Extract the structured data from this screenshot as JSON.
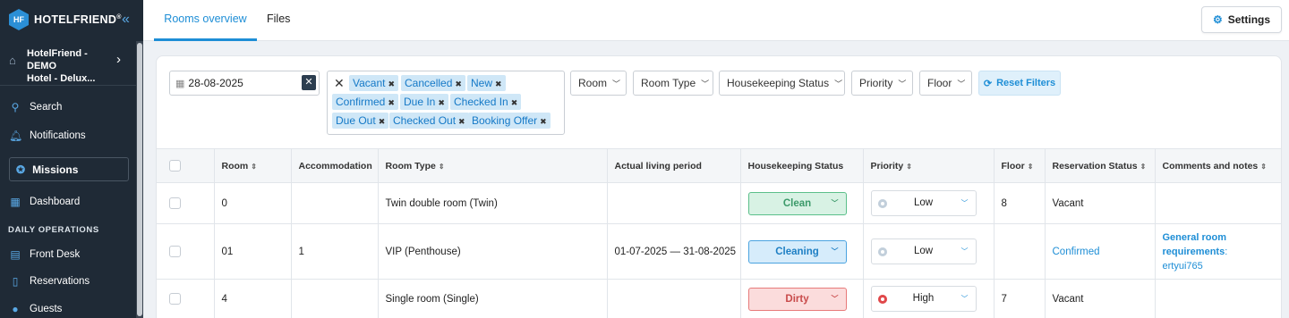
{
  "brand": {
    "name": "HOTELFRIEND",
    "reg": "®",
    "mark": "HF"
  },
  "hotel": {
    "line1": "HotelFriend - DEMO",
    "line2": "Hotel - Delux..."
  },
  "nav": {
    "search": "Search",
    "notifications": "Notifications",
    "missions": "Missions",
    "dashboard": "Dashboard",
    "section_daily": "DAILY OPERATIONS",
    "front_desk": "Front Desk",
    "reservations": "Reservations",
    "guests": "Guests"
  },
  "tabs": {
    "rooms_overview": "Rooms overview",
    "files": "Files"
  },
  "settings_label": "Settings",
  "filters": {
    "date_value": "28-08-2025",
    "status_chips": [
      "Vacant",
      "Cancelled",
      "New",
      "Confirmed",
      "Due In",
      "Checked In",
      "Due Out",
      "Checked Out",
      "Booking Offer"
    ],
    "room": "Room",
    "room_type": "Room Type",
    "housekeeping_status": "Housekeeping Status",
    "priority": "Priority",
    "floor": "Floor",
    "reset": "Reset Filters"
  },
  "table": {
    "headers": {
      "room": "Room",
      "accommodation": "Accommodation",
      "room_type": "Room Type",
      "living_period": "Actual living period",
      "housekeeping": "Housekeeping Status",
      "priority": "Priority",
      "floor": "Floor",
      "reservation_status": "Reservation Status",
      "comments": "Comments and notes"
    },
    "rows": [
      {
        "room": "0",
        "accommodation": "",
        "room_type": "Twin double room (Twin)",
        "period": "",
        "housekeeping": "Clean",
        "priority": "Low",
        "floor": "8",
        "reservation_status": "Vacant",
        "comment_title": "",
        "comment_text": ""
      },
      {
        "room": "01",
        "accommodation": "1",
        "room_type": "VIP (Penthouse)",
        "period": "01-07-2025 — 31-08-2025",
        "housekeeping": "Cleaning",
        "priority": "Low",
        "floor": "",
        "reservation_status": "Confirmed",
        "comment_title": "General room requirements",
        "comment_text": "ertyui765"
      },
      {
        "room": "4",
        "accommodation": "",
        "room_type": "Single room (Single)",
        "period": "",
        "housekeeping": "Dirty",
        "priority": "High",
        "floor": "7",
        "reservation_status": "Vacant",
        "comment_title": "",
        "comment_text": ""
      }
    ]
  }
}
